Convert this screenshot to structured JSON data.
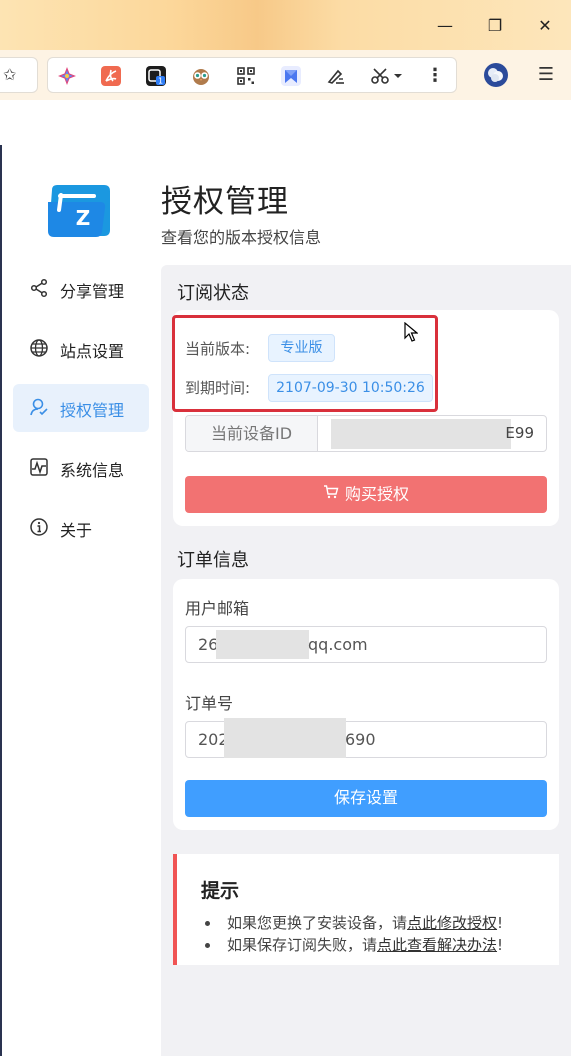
{
  "window": {
    "minimize_glyph": "—",
    "restore_glyph": "❐",
    "close_glyph": "✕"
  },
  "toolbar": {
    "extensions": [
      {
        "name": "sparkle-extension-icon",
        "color": "#e0467c"
      },
      {
        "name": "pdf-extension-icon",
        "color": "#f06a50"
      },
      {
        "name": "calendar-extension-icon",
        "color": "#1d1d1d",
        "badge": "1"
      },
      {
        "name": "owl-extension-icon",
        "color": "#a26a3c"
      },
      {
        "name": "qr-code-extension-icon",
        "color": "#333333"
      },
      {
        "name": "bookmark-extension-icon",
        "color": "#4b77f0"
      },
      {
        "name": "pen-extension-icon",
        "color": "#333333"
      },
      {
        "name": "scissors-extension-icon",
        "color": "#333333"
      }
    ]
  },
  "brand": {
    "logo_letter": "Z",
    "accent": "#409eff"
  },
  "page": {
    "title": "授权管理",
    "subtitle": "查看您的版本授权信息"
  },
  "sidebar": {
    "items": [
      {
        "label": "分享管理",
        "icon": "share-icon",
        "active": false
      },
      {
        "label": "站点设置",
        "icon": "globe-icon",
        "active": false
      },
      {
        "label": "授权管理",
        "icon": "user-icon",
        "active": true
      },
      {
        "label": "系统信息",
        "icon": "activity-icon",
        "active": false
      },
      {
        "label": "关于",
        "icon": "info-icon",
        "active": false
      }
    ]
  },
  "subscription": {
    "section_title": "订阅状态",
    "version_label": "当前版本:",
    "version_value": "专业版",
    "expiry_label": "到期时间:",
    "expiry_value": "2107-09-30 10:50:26",
    "device_id_label": "当前设备ID",
    "device_id_visible_suffix": "E99",
    "buy_button": "购买授权"
  },
  "order": {
    "section_title": "订单信息",
    "email_label": "用户邮箱",
    "email_prefix": "26",
    "email_suffix": "qq.com",
    "order_no_label": "订单号",
    "order_no_prefix": "202",
    "order_no_suffix": "690",
    "save_button": "保存设置"
  },
  "tips": {
    "title": "提示",
    "items": [
      {
        "text": "如果您更换了安装设备，请",
        "link": "点此修改授权",
        "end": "!"
      },
      {
        "text": "如果保存订阅失败，请",
        "link": "点此查看解决办法",
        "end": "!"
      }
    ]
  },
  "colors": {
    "danger": "#f27272",
    "primary": "#409eff",
    "highlight_border": "#d9303b"
  }
}
